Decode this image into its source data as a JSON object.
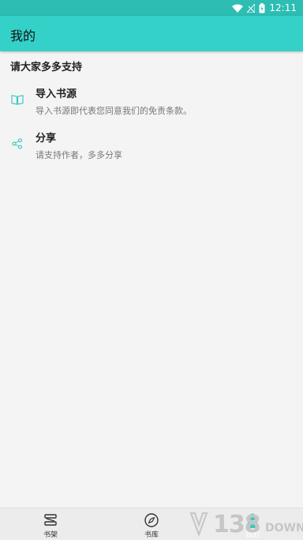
{
  "status_bar": {
    "time": "12:11"
  },
  "app_bar": {
    "title": "我的"
  },
  "section": {
    "title": "请大家多多支持"
  },
  "menu": [
    {
      "title": "导入书源",
      "description": "导入书源即代表您同意我们的免责条款。",
      "icon": "book-open-icon"
    },
    {
      "title": "分享",
      "description": "请支持作者，多多分享",
      "icon": "share-icon"
    }
  ],
  "bottom_nav": [
    {
      "label": "书架",
      "icon": "bookshelf-icon",
      "active": false
    },
    {
      "label": "书库",
      "icon": "compass-icon",
      "active": false
    },
    {
      "label": "我的",
      "icon": "person-icon",
      "active": true
    }
  ],
  "watermark": {
    "digits": "138",
    "word": "DOWN"
  },
  "colors": {
    "primary": "#34d1c8",
    "status_bar": "#2dbdb3",
    "accent": "#3cc9c0"
  }
}
